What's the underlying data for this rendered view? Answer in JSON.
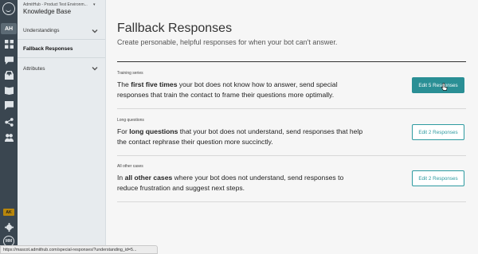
{
  "rail": {
    "user_initials": "AH",
    "badge": "AK",
    "bottom_logo": "MM",
    "icons": [
      "home-icon",
      "dashboard-icon",
      "chat-icon",
      "inbox-icon",
      "book-icon",
      "knowledge-icon",
      "comment-icon",
      "share-icon",
      "users-icon",
      "settings-icon"
    ]
  },
  "nav": {
    "environment": "AdmitHub - Product Test Environm...",
    "section_title": "Knowledge Base",
    "items": [
      {
        "label": "Understandings",
        "chevron": true,
        "active": false
      },
      {
        "label": "Fallback Responses",
        "chevron": false,
        "active": true
      },
      {
        "label": "Attributes",
        "chevron": true,
        "active": false
      }
    ]
  },
  "main": {
    "title": "Fallback Responses",
    "subtitle": "Create personable, helpful responses for when your bot can't answer."
  },
  "cards": [
    {
      "tag": "Training series",
      "pre": "The ",
      "bold": "first five times",
      "post": " your bot does not know how to answer, send special responses that train the contact to frame their questions more optimally.",
      "button": "Edit 5 Responses"
    },
    {
      "tag": "Long questions",
      "pre": "For ",
      "bold": "long questions",
      "post": " that your bot does not understand, send responses that help the contact rephrase their question more succinctly.",
      "button": "Edit 2 Responses"
    },
    {
      "tag": "All other cases",
      "pre": "In ",
      "bold": "all other cases",
      "post": " where your bot does not understand, send responses to reduce frustration and suggest next steps.",
      "button": "Edit 2 Responses"
    }
  ],
  "status_url": "https://mascot.admithub.com/special-responses/?understanding_id=5...",
  "colors": {
    "accent": "#2a8f95",
    "rail": "#3a4650",
    "nav": "#e7ebee"
  }
}
